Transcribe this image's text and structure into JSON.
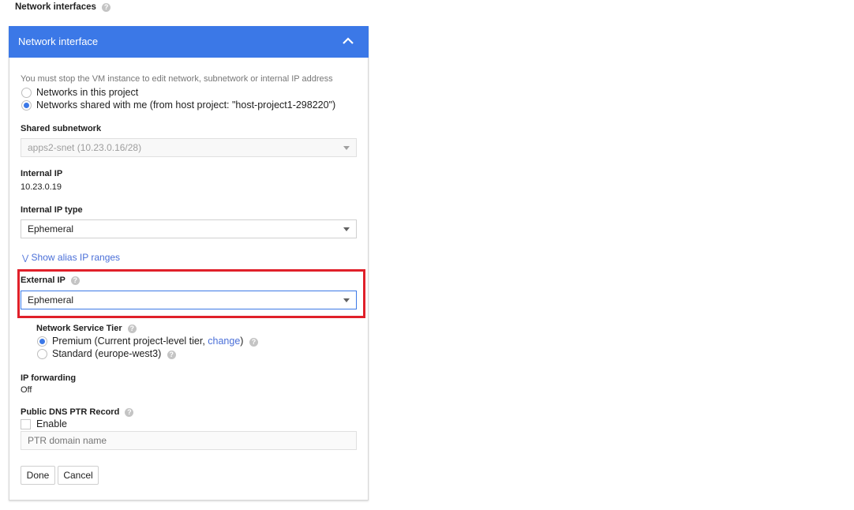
{
  "section_title": "Network interfaces",
  "panel": {
    "title": "Network interface",
    "notice": "You must stop the VM instance to edit network, subnetwork or internal IP address",
    "network_options": [
      "Networks in this project",
      "Networks shared with me (from host project: \"host-project1-298220\")"
    ],
    "selected_network_option": 1,
    "shared_subnetwork": {
      "label": "Shared subnetwork",
      "value": "apps2-snet (10.23.0.16/28)"
    },
    "internal_ip": {
      "label": "Internal IP",
      "value": "10.23.0.19"
    },
    "internal_ip_type": {
      "label": "Internal IP type",
      "value": "Ephemeral"
    },
    "alias_link": "Show alias IP ranges",
    "external_ip": {
      "label": "External IP",
      "value": "Ephemeral"
    },
    "tier": {
      "label": "Network Service Tier",
      "premium_prefix": "Premium (Current project-level tier, ",
      "change_link": "change",
      "premium_suffix": ")",
      "standard": "Standard (europe-west3)"
    },
    "ip_forwarding": {
      "label": "IP forwarding",
      "value": "Off"
    },
    "ptr": {
      "label": "Public DNS PTR Record",
      "enable": "Enable",
      "placeholder": "PTR domain name"
    },
    "done": "Done",
    "cancel": "Cancel"
  },
  "colors": {
    "accent": "#3b78e7",
    "highlight": "#e0202a"
  }
}
